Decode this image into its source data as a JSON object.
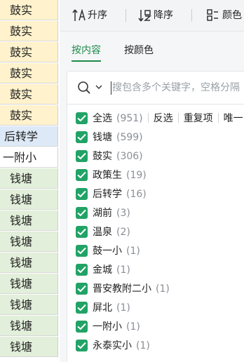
{
  "sheet": {
    "cells": [
      {
        "text": "鼓实",
        "color": "#fff2cc"
      },
      {
        "text": "鼓实",
        "color": "#fff2cc"
      },
      {
        "text": "鼓实",
        "color": "#fff2cc"
      },
      {
        "text": "鼓实",
        "color": "#fff2cc"
      },
      {
        "text": "鼓实",
        "color": "#fff2cc"
      },
      {
        "text": "鼓实",
        "color": "#fff2cc"
      },
      {
        "text": "后转学",
        "color": "#dde9f7"
      },
      {
        "text": "一附小",
        "color": "#ffffff"
      },
      {
        "text": "钱塘",
        "color": "#e2efda"
      },
      {
        "text": "钱塘",
        "color": "#e2efda"
      },
      {
        "text": "钱塘",
        "color": "#e2efda"
      },
      {
        "text": "钱塘",
        "color": "#e2efda"
      },
      {
        "text": "钱塘",
        "color": "#e2efda"
      },
      {
        "text": "钱塘",
        "color": "#e2efda"
      },
      {
        "text": "钱塘",
        "color": "#e2efda"
      },
      {
        "text": "钱塘",
        "color": "#e2efda"
      },
      {
        "text": "钱塘",
        "color": "#e2efda"
      }
    ]
  },
  "toolbar": {
    "sort_asc_label": "升序",
    "sort_desc_label": "降序",
    "color_sort_label": "颜色"
  },
  "tabs": {
    "by_content": "按内容",
    "by_color": "按颜色"
  },
  "search": {
    "placeholder": "搜包含多个关键字，空格分隔"
  },
  "all_row": {
    "label": "全选",
    "count": "(951)",
    "invert": "反选",
    "duplicates": "重复项",
    "unique": "唯一"
  },
  "items": [
    {
      "label": "钱塘",
      "count": "(599)",
      "checked": true
    },
    {
      "label": "鼓实",
      "count": "(306)",
      "checked": true
    },
    {
      "label": "政策生",
      "count": "(19)",
      "checked": true
    },
    {
      "label": "后转学",
      "count": "(16)",
      "checked": true
    },
    {
      "label": "湖前",
      "count": "(3)",
      "checked": true
    },
    {
      "label": "温泉",
      "count": "(2)",
      "checked": true
    },
    {
      "label": "鼓一小",
      "count": "(1)",
      "checked": true
    },
    {
      "label": "金城",
      "count": "(1)",
      "checked": true
    },
    {
      "label": "晋安教附二小",
      "count": "(1)",
      "checked": true
    },
    {
      "label": "屏北",
      "count": "(1)",
      "checked": true
    },
    {
      "label": "一附小",
      "count": "(1)",
      "checked": true
    },
    {
      "label": "永泰实小",
      "count": "(1)",
      "checked": true
    }
  ],
  "colors": {
    "accent": "#1f8a4c",
    "checkbox": "#21a366"
  },
  "icons": [
    "sort-ascending-icon",
    "sort-descending-icon",
    "color-sort-icon",
    "search-icon",
    "chevron-down-icon",
    "checkmark-icon"
  ]
}
